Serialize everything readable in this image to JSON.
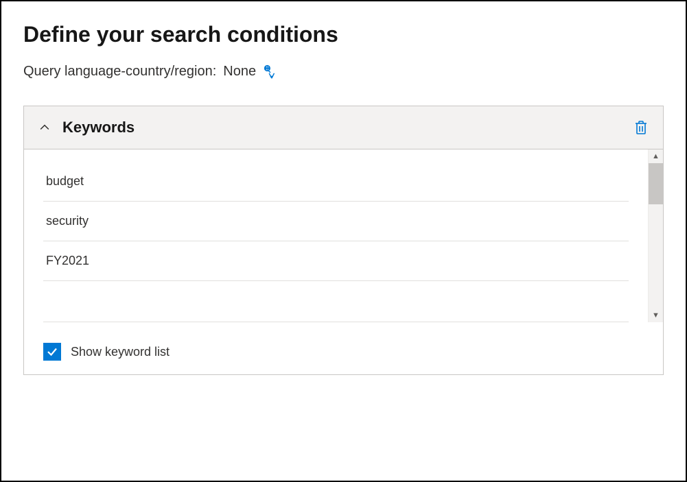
{
  "page": {
    "title": "Define your search conditions",
    "query_language_label": "Query language-country/region:",
    "query_language_value": "None"
  },
  "panel": {
    "title": "Keywords",
    "keywords": [
      "budget",
      "security",
      "FY2021",
      ""
    ],
    "show_keyword_list_label": "Show keyword list",
    "show_keyword_list_checked": true
  },
  "colors": {
    "accent": "#0078d4"
  }
}
